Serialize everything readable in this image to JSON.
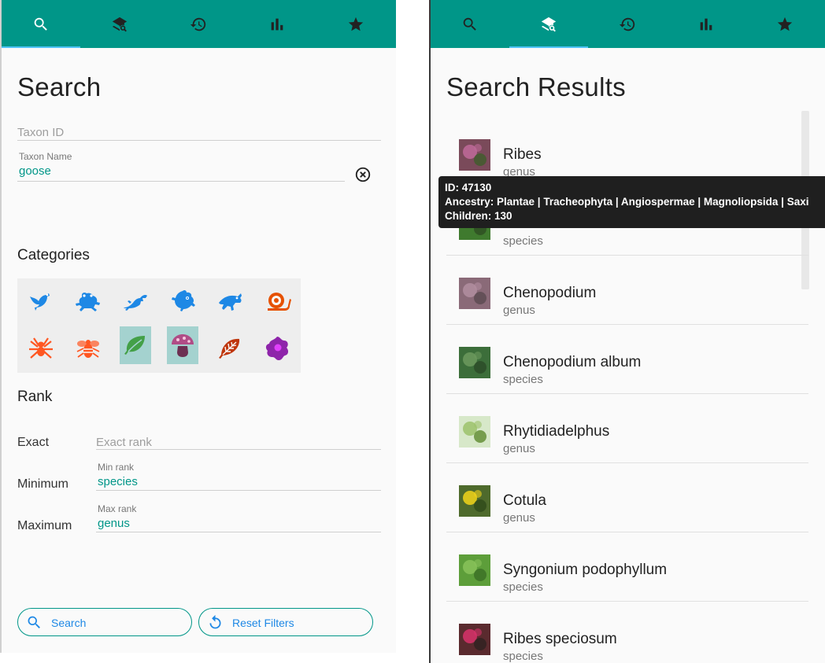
{
  "tabs": [
    {
      "icon": "search-icon"
    },
    {
      "icon": "layered-search-icon"
    },
    {
      "icon": "history-icon"
    },
    {
      "icon": "bar-chart-icon"
    },
    {
      "icon": "star-icon"
    }
  ],
  "colors": {
    "accent": "#009688",
    "tab_indicator": "#4fc3f7",
    "button_text": "#1e88e5",
    "selected_category": "#a4d2cf"
  },
  "search_screen": {
    "title": "Search",
    "taxon_id": {
      "placeholder": "Taxon ID",
      "value": ""
    },
    "taxon_name": {
      "label": "Taxon Name",
      "value": "goose"
    },
    "categories_title": "Categories",
    "categories": [
      {
        "name": "Birds",
        "icon": "bird-icon",
        "color": "#1e88e5",
        "selected": false
      },
      {
        "name": "Amphibians",
        "icon": "frog-icon",
        "color": "#1e88e5",
        "selected": false
      },
      {
        "name": "Reptiles",
        "icon": "lizard-icon",
        "color": "#1e88e5",
        "selected": false
      },
      {
        "name": "Mammals",
        "icon": "mammal-icon",
        "color": "#1e88e5",
        "selected": false
      },
      {
        "name": "Fish",
        "icon": "fish-icon",
        "color": "#1e88e5",
        "selected": false
      },
      {
        "name": "Mollusks",
        "icon": "snail-icon",
        "color": "#e65100",
        "selected": false
      },
      {
        "name": "Arachnids",
        "icon": "spider-icon",
        "color": "#ff5722",
        "selected": false
      },
      {
        "name": "Insects",
        "icon": "bee-icon",
        "color": "#ff5722",
        "selected": false
      },
      {
        "name": "Plants",
        "icon": "leaf-icon",
        "color": "#43a047",
        "selected": true
      },
      {
        "name": "Fungi",
        "icon": "mushroom-icon",
        "color": "#8e3b6b",
        "selected": true
      },
      {
        "name": "Chromista",
        "icon": "kelp-icon",
        "color": "#bf360c",
        "selected": false
      },
      {
        "name": "Protozoa",
        "icon": "amoeba-icon",
        "color": "#8e24aa",
        "selected": false
      }
    ],
    "rank_title": "Rank",
    "rank_exact": {
      "row_label": "Exact",
      "placeholder": "Exact rank",
      "value": ""
    },
    "rank_min": {
      "row_label": "Minimum",
      "label": "Min rank",
      "value": "species"
    },
    "rank_max": {
      "row_label": "Maximum",
      "label": "Max rank",
      "value": "genus"
    },
    "search_button": "Search",
    "reset_button": "Reset Filters"
  },
  "results_screen": {
    "title": "Search Results",
    "results": [
      {
        "name": "Ribes",
        "rank": "genus",
        "thumb": [
          "#7a4a5a",
          "#c06a9a",
          "#3e5c2a"
        ]
      },
      {
        "name": "",
        "rank": "species",
        "thumb": [
          "#3f7a2e",
          "#6aa84f",
          "#2e4d22"
        ]
      },
      {
        "name": "Chenopodium",
        "rank": "genus",
        "thumb": [
          "#8a6a78",
          "#b28ea0",
          "#5a4a50"
        ]
      },
      {
        "name": "Chenopodium album",
        "rank": "species",
        "thumb": [
          "#3c6e3a",
          "#6c9a5e",
          "#2a4a28"
        ]
      },
      {
        "name": "Rhytidiadelphus",
        "rank": "genus",
        "thumb": [
          "#d7e8c9",
          "#9cc26b",
          "#5e8a2e"
        ]
      },
      {
        "name": "Cotula",
        "rank": "genus",
        "thumb": [
          "#4e6a2c",
          "#f2d31a",
          "#2f4a1a"
        ]
      },
      {
        "name": "Syngonium podophyllum",
        "rank": "species",
        "thumb": [
          "#5d9e3a",
          "#88c25a",
          "#3b6e25"
        ]
      },
      {
        "name": "Ribes speciosum",
        "rank": "species",
        "thumb": [
          "#5a2a2e",
          "#d8326a",
          "#2e2220"
        ]
      }
    ],
    "tooltip": {
      "line1": "ID: 47130",
      "line2": "Ancestry: Plantae | Tracheophyta | Angiospermae | Magnoliopsida | Saxi",
      "line3": "Children: 130"
    }
  }
}
